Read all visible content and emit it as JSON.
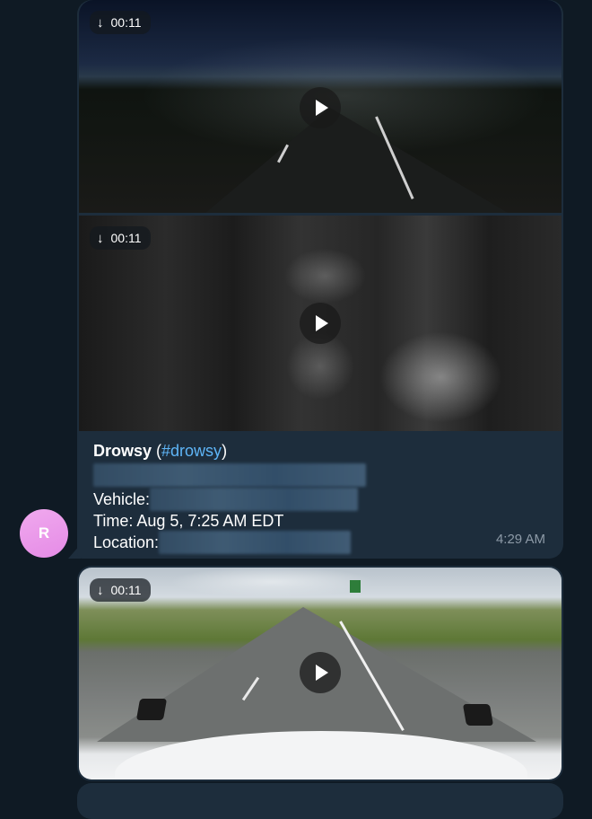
{
  "messages": [
    {
      "videos": [
        {
          "duration": "00:11",
          "download_icon": "↓",
          "scene": "night highway road camera"
        },
        {
          "duration": "00:11",
          "download_icon": "↓",
          "scene": "in-cab driver camera"
        }
      ],
      "caption": {
        "title": "Drowsy",
        "hashtag_open": " (",
        "hashtag": "#drowsy",
        "hashtag_close": ")",
        "vehicle_label": "Vehicle:",
        "time_label": "Time: Aug 5, 7:25 AM EDT",
        "location_label": "Location:"
      },
      "timestamp": "4:29 AM",
      "avatar_initial": "R"
    },
    {
      "videos": [
        {
          "duration": "00:11",
          "download_icon": "↓",
          "scene": "daytime highway road camera"
        }
      ]
    }
  ],
  "colors": {
    "background": "#0f1a24",
    "bubble": "#1d2d3c",
    "hashtag": "#5eb5f7",
    "timestamp": "#8d9aa7",
    "avatar": "#e58be6"
  },
  "icons": [
    "download-arrow-icon",
    "play-icon"
  ]
}
